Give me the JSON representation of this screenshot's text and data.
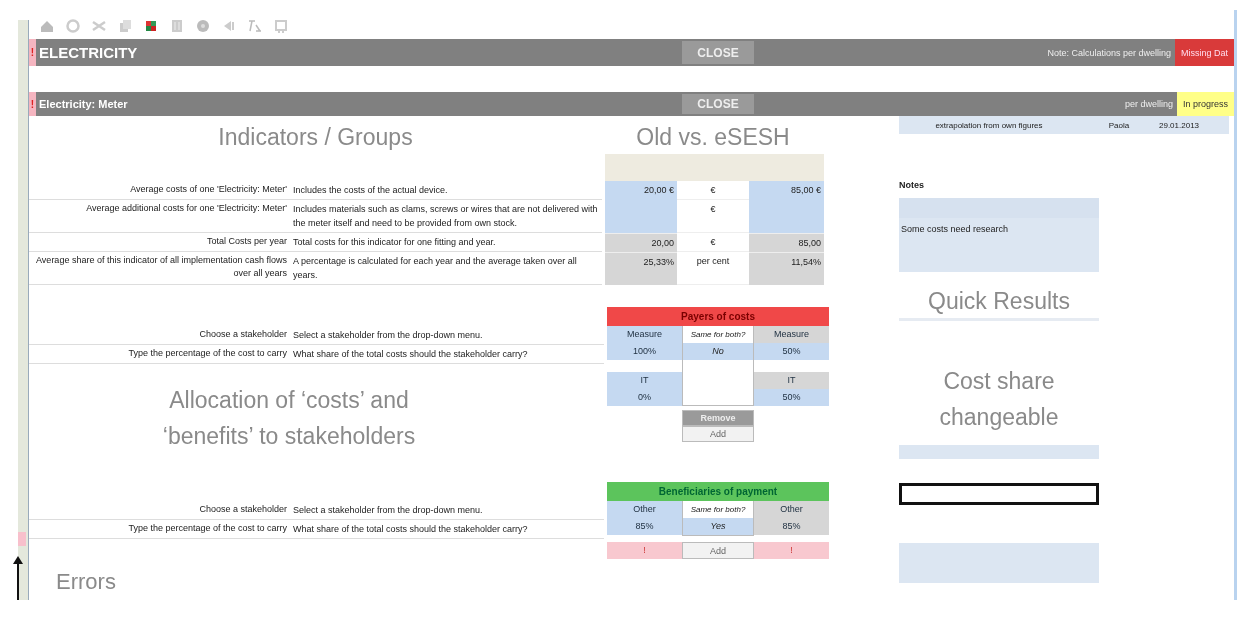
{
  "sections": [
    {
      "marker": "!",
      "title": "ELECTRICITY",
      "kind": "group",
      "close": "CLOSE",
      "note": "Note: Calculations per dwelling",
      "status": {
        "label": "Missing Dat",
        "kind": "missing"
      }
    },
    {
      "marker": "!",
      "title": "Electricity: Meter",
      "kind": "item",
      "close": "CLOSE",
      "note": "per dwelling",
      "status": {
        "label": "In progress",
        "kind": "progress"
      }
    }
  ],
  "meta": [
    "extrapolation from own figures",
    "Paola",
    "29.01.2013"
  ],
  "indicators_heading": "Indicators / Groups",
  "comparison_heading": "Old vs. eSESH",
  "indicators": [
    {
      "label": "Average costs of one 'Electricity: Meter'",
      "description": "Includes the costs of the actual device.",
      "old": "20,00 €",
      "unit": "€",
      "new": "85,00 €",
      "kind": "input"
    },
    {
      "label": "Average additional costs for one 'Electricity: Meter'",
      "description": "Includes materials such as clams, screws or wires that are not delivered with the meter itself and need to be provided from own stock.",
      "unit": "€",
      "kind": "input"
    },
    {
      "label": "Total Costs per year",
      "description": "Total costs for this indicator for one fitting and year.",
      "old": "20,00",
      "unit": "€",
      "new": "85,00",
      "kind": "computed"
    },
    {
      "label": "Average share of this indicator of all implementation cash flows over all years",
      "description": "A percentage is calculated for each year and the average taken over all years.",
      "old": "25,33%",
      "unit": "per cent",
      "new": "11,54%",
      "kind": "computed"
    }
  ],
  "allocation_heading": "Allocation of ‘costs’ and ‘benefits’ to stakeholders",
  "tables": [
    {
      "kind": "payers",
      "title": "Payers of costs",
      "rows": [
        {
          "label": "Choose a stakeholder",
          "description": "Select a stakeholder from the drop-down menu."
        },
        {
          "label": "Type the percentage of the cost to carry",
          "description": "What share of the total costs should the stakeholder carry?"
        }
      ],
      "same_label": "Same for both?",
      "same_value": "No",
      "entries": [
        {
          "left_name": "Measure",
          "left_share": "100%",
          "right_name": "Measure",
          "right_share": "50%"
        },
        {
          "left_name": "IT",
          "left_share": "0%",
          "right_name": "IT",
          "right_share": "50%"
        }
      ],
      "buttons": [
        {
          "label": "Remove",
          "kind": "remove"
        },
        {
          "label": "Add",
          "kind": "add"
        }
      ]
    },
    {
      "kind": "beneficiaries",
      "title": "Beneficiaries of payment",
      "rows": [
        {
          "label": "Choose a stakeholder",
          "description": "Select a stakeholder from the drop-down menu."
        },
        {
          "label": "Type the percentage of the cost to carry",
          "description": "What share of the total costs should the stakeholder carry?"
        }
      ],
      "same_label": "Same for both?",
      "same_value": "Yes",
      "entries": [
        {
          "left_name": "Other",
          "left_share": "85%",
          "right_name": "Other",
          "right_share": "85%"
        }
      ],
      "buttons": [
        {
          "label": "Add",
          "kind": "add"
        }
      ],
      "errors": [
        "!",
        "!"
      ]
    }
  ],
  "notes": {
    "title": "Notes",
    "text": "Some costs need research"
  },
  "quick_results_heading": "Quick Results",
  "cost_share_heading": "Cost share changeable",
  "errors_heading": "Errors"
}
